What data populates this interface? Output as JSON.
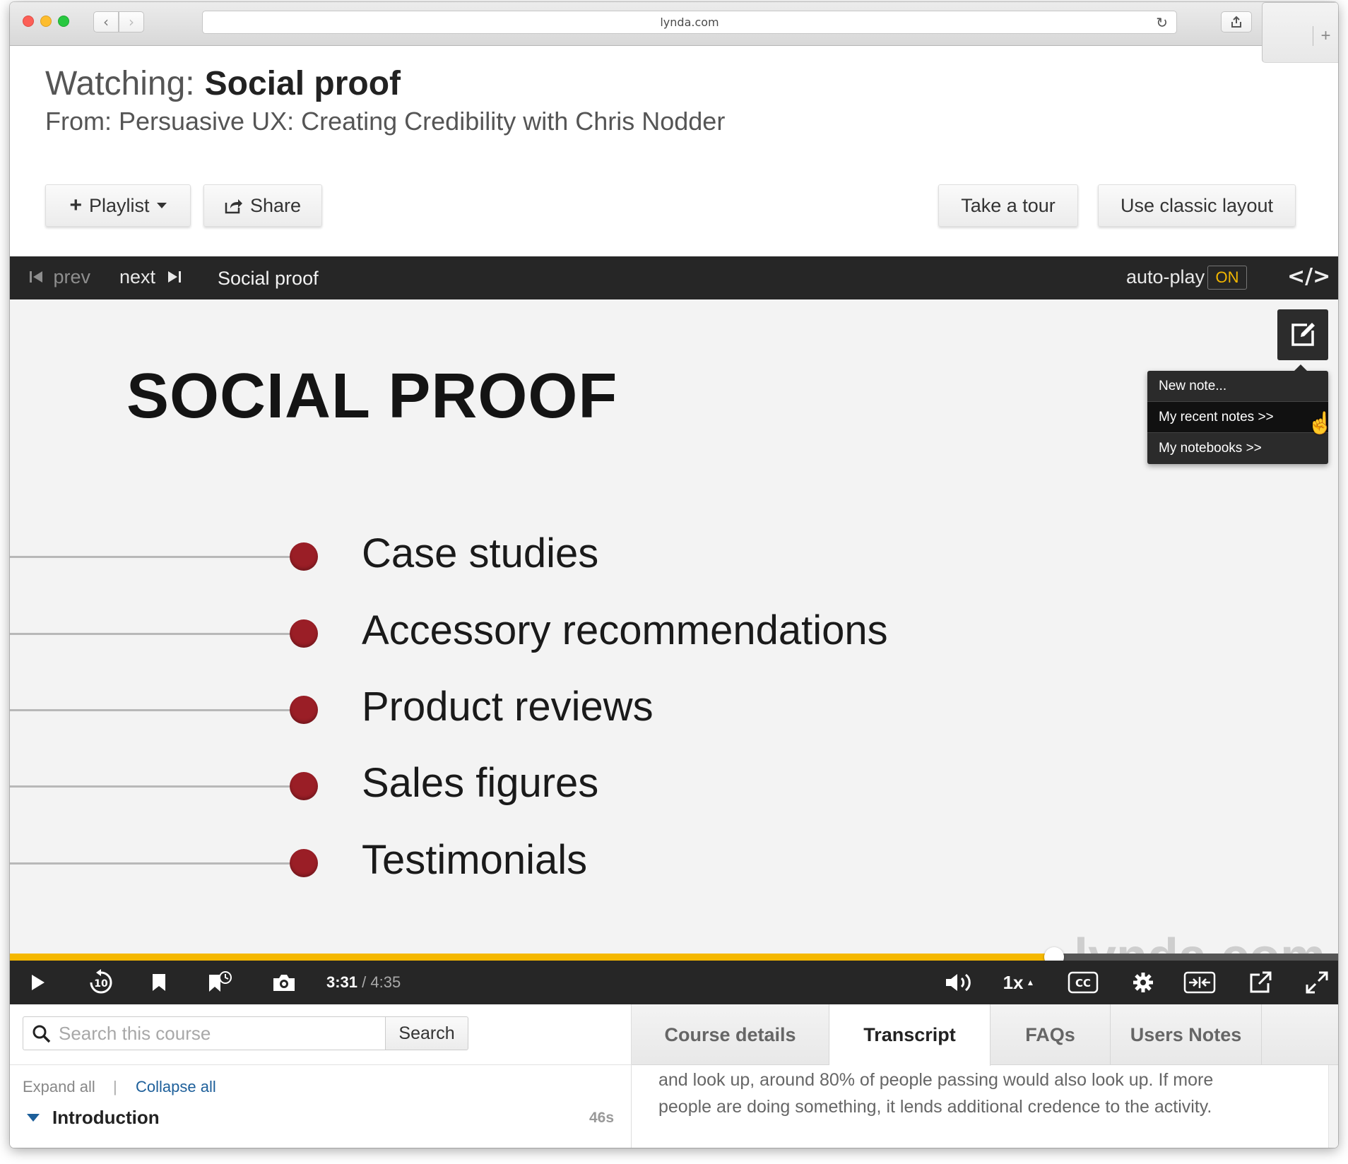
{
  "browser": {
    "url": "lynda.com"
  },
  "header": {
    "watching_prefix": "Watching:",
    "watching_title": "Social proof",
    "from": "From: Persuasive UX: Creating Credibility with Chris Nodder",
    "buttons": {
      "playlist": "Playlist",
      "share": "Share",
      "tour": "Take a tour",
      "classic": "Use classic layout"
    }
  },
  "player_bar": {
    "prev": "prev",
    "next": "next",
    "title": "Social proof",
    "autoplay_label": "auto-play",
    "autoplay_state": "ON",
    "embed": "</>"
  },
  "slide": {
    "title": "SOCIAL PROOF",
    "bullets": [
      "Case studies",
      "Accessory recommendations",
      "Product reviews",
      "Sales figures",
      "Testimonials"
    ],
    "watermark": "lynda.com",
    "bullet_color": "#9a1e26"
  },
  "notes_menu": {
    "items": [
      "New note...",
      "My recent notes >>",
      "My notebooks >>"
    ],
    "highlighted": "My recent notes >>"
  },
  "playback": {
    "current": "3:31",
    "separator": "/",
    "duration": "4:35",
    "progress_fraction": 0.786,
    "speed": "1x",
    "progress_color": "#f5b800"
  },
  "search": {
    "placeholder": "Search this course",
    "button": "Search"
  },
  "toc": {
    "expand_all": "Expand all",
    "separator": "|",
    "collapse_all": "Collapse all",
    "chapter": "Introduction",
    "chapter_time": "46s"
  },
  "tabs": [
    "Course details",
    "Transcript",
    "FAQs",
    "Users Notes"
  ],
  "active_tab": "Transcript",
  "transcript": {
    "lines": [
      "and look up, around 80% of people passing would also look up. If more",
      "people are doing something, it lends additional credence to the activity."
    ]
  }
}
